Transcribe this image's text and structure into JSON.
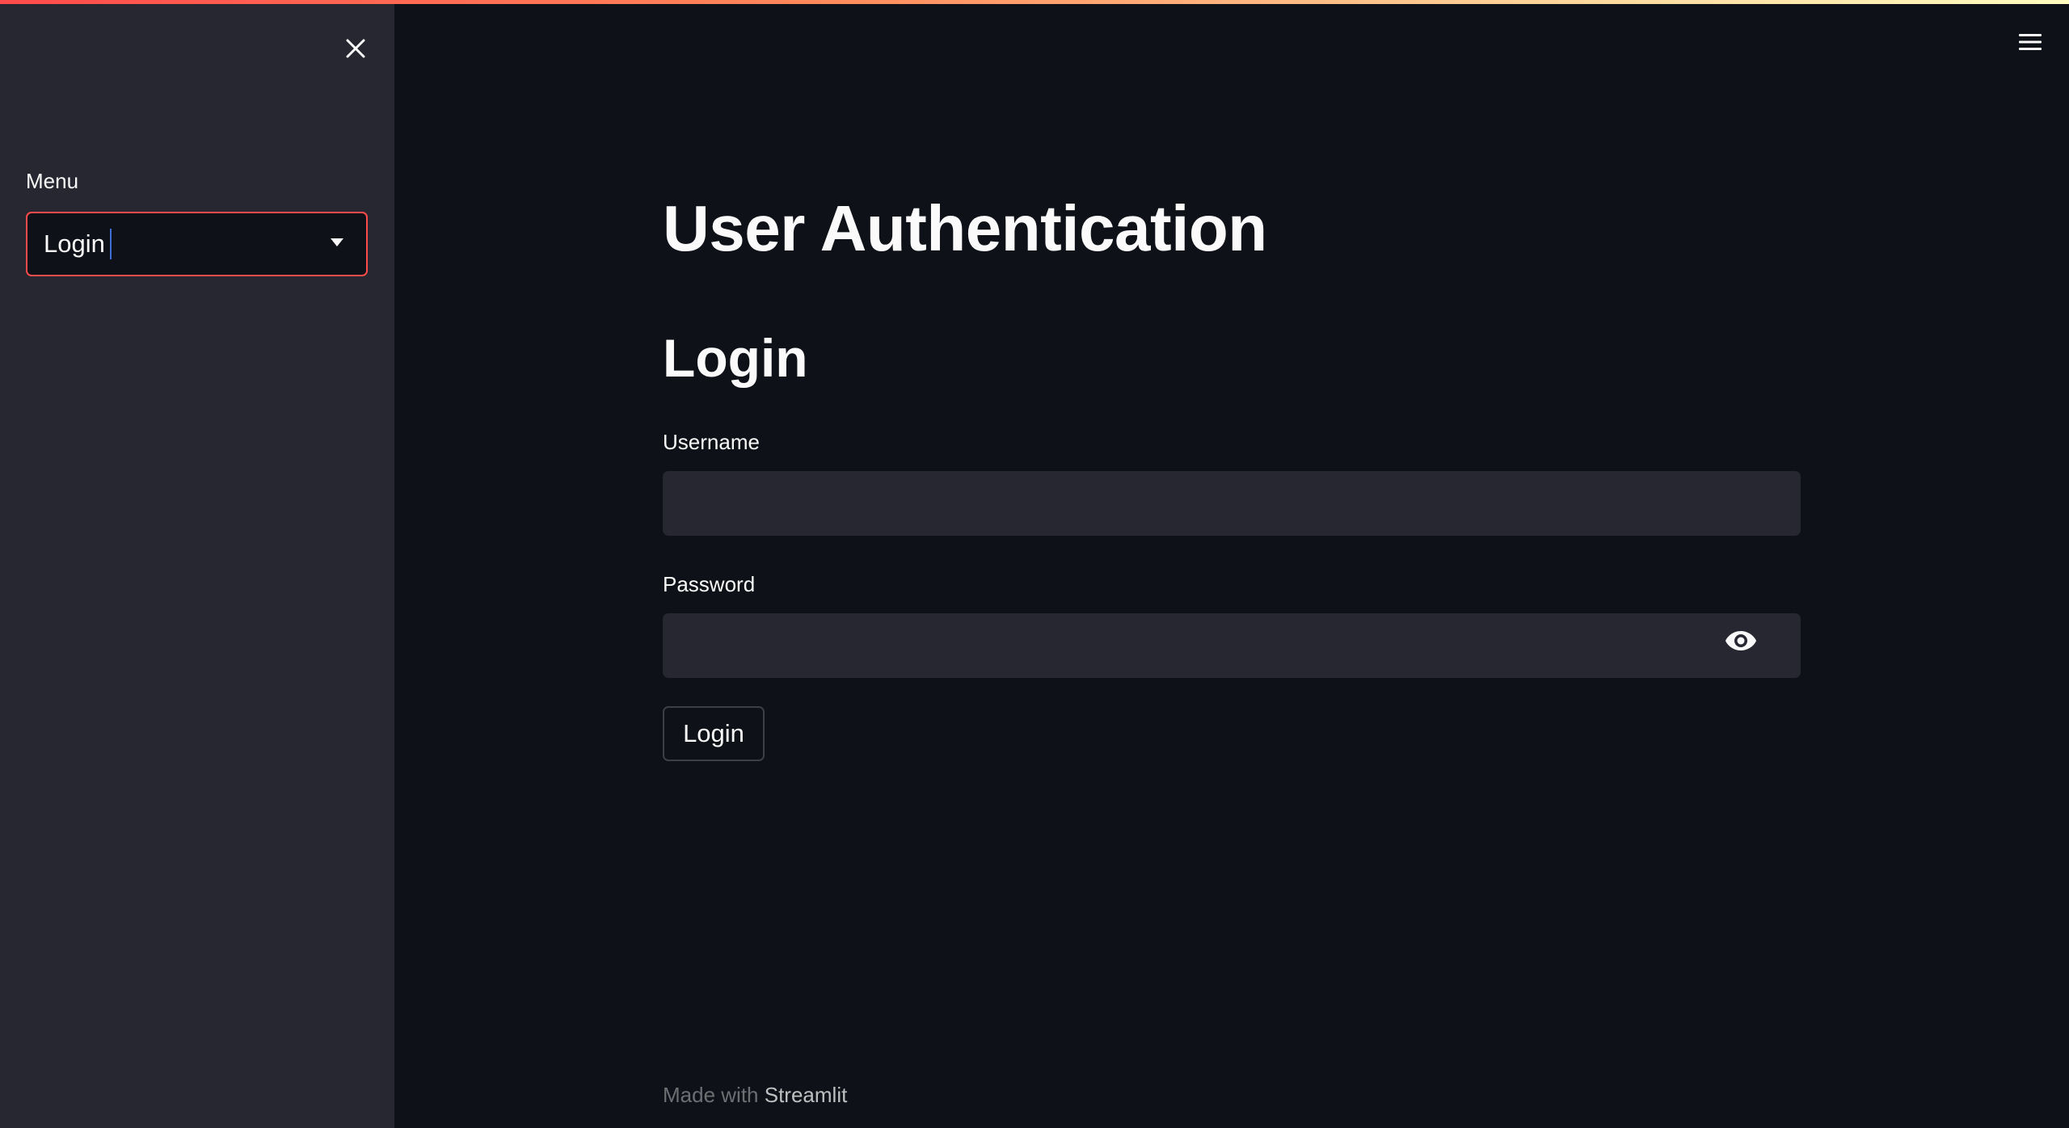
{
  "sidebar": {
    "label": "Menu",
    "select": {
      "value": "Login"
    },
    "close_icon": "close-icon"
  },
  "header": {
    "menu_icon": "hamburger-menu-icon"
  },
  "main": {
    "title": "User Authentication",
    "section_title": "Login",
    "username": {
      "label": "Username",
      "value": "",
      "placeholder": ""
    },
    "password": {
      "label": "Password",
      "value": "",
      "placeholder": "",
      "toggle_icon": "eye-icon"
    },
    "login_button": "Login"
  },
  "footer": {
    "prefix": "Made with",
    "brand": "Streamlit"
  },
  "colors": {
    "background": "#0e1117",
    "sidebar": "#262730",
    "input": "#262730",
    "accent": "#ff4b4b",
    "text": "#fafafa"
  }
}
